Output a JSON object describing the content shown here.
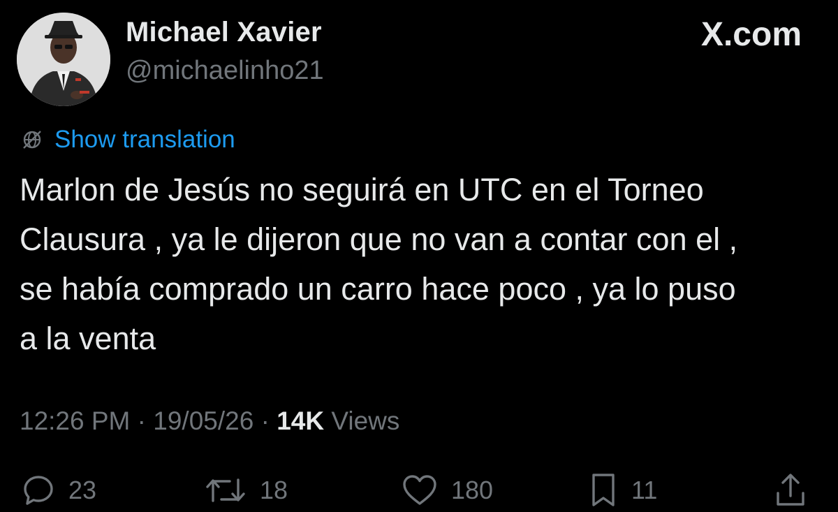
{
  "author": {
    "display_name": "Michael Xavier",
    "handle": "@michaelinho21",
    "avatar_icon": "profile-photo"
  },
  "brand": {
    "label": "X.com"
  },
  "translation": {
    "icon": "globe-icon",
    "label": "Show translation"
  },
  "tweet": {
    "text_lines": [
      "Marlon de Jesús no seguirá en UTC en el Torneo",
      "Clausura , ya le dijeron que no van a contar con el ,",
      "se había comprado un carro hace poco , ya lo puso",
      "a la venta"
    ]
  },
  "meta": {
    "time": "12:26 PM",
    "separator": "·",
    "date": "19/05/26",
    "views_count": "14K",
    "views_label": "Views"
  },
  "actions": {
    "reply_count": "23",
    "repost_count": "18",
    "like_count": "180",
    "bookmark_count": "11"
  },
  "colors": {
    "background": "#000000",
    "text": "#e7e9ea",
    "secondary": "#71767b",
    "link": "#1d9bf0"
  }
}
